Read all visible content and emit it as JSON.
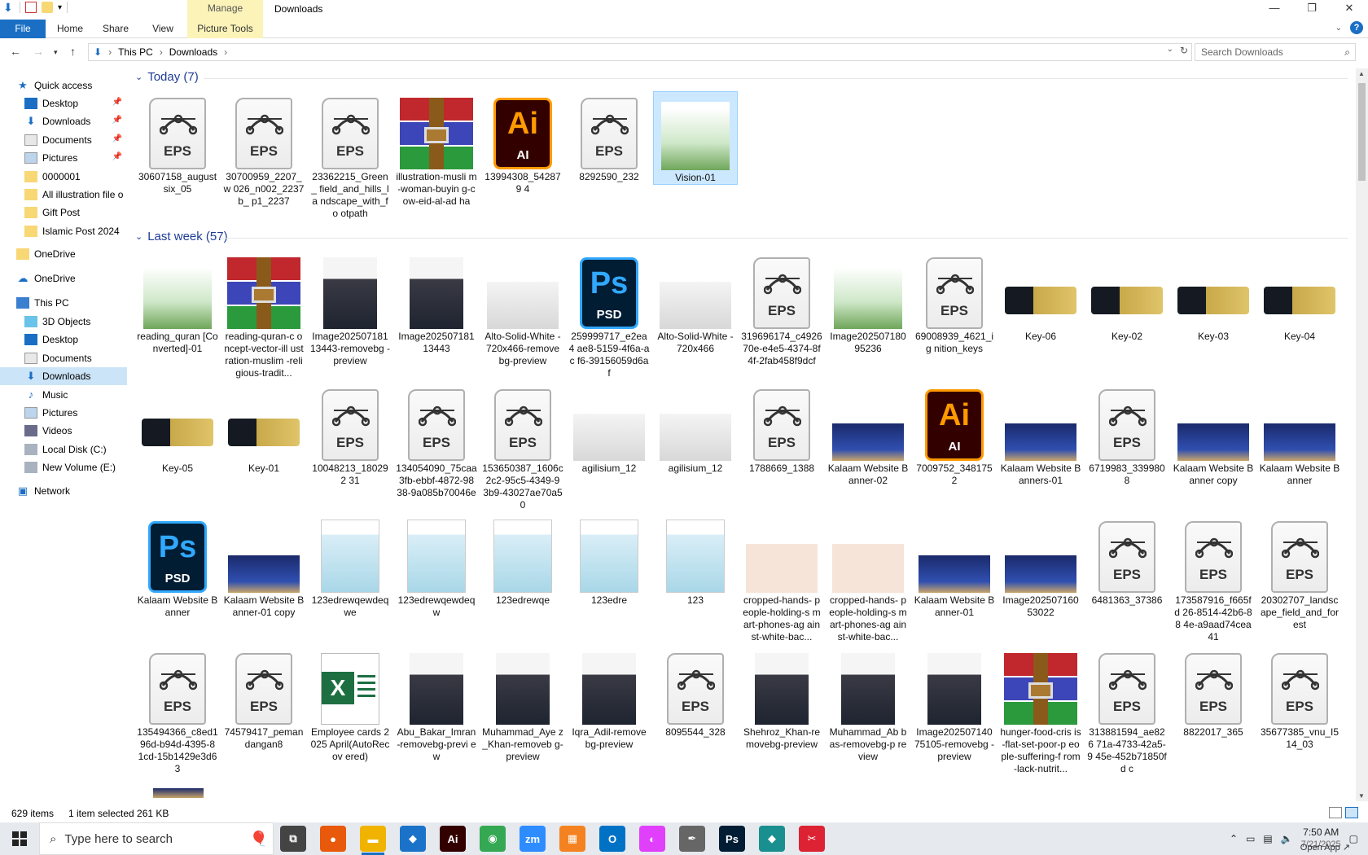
{
  "window": {
    "title": "Downloads",
    "contextual_tab_group": "Manage",
    "controls": {
      "minimize": "—",
      "restore": "❐",
      "close": "✕"
    }
  },
  "ribbon": {
    "tabs": [
      "File",
      "Home",
      "Share",
      "View"
    ],
    "contextual_tab": "Picture Tools",
    "help": "?"
  },
  "address": {
    "crumbs": [
      "This PC",
      "Downloads"
    ],
    "search_placeholder": "Search Downloads"
  },
  "sidebar": {
    "items": [
      {
        "label": "Quick access",
        "icon": "star-icon",
        "pinned": false
      },
      {
        "label": "Desktop",
        "icon": "desktop-icon",
        "pinned": true
      },
      {
        "label": "Downloads",
        "icon": "download-arrow-icon",
        "pinned": true
      },
      {
        "label": "Documents",
        "icon": "documents-icon",
        "pinned": true
      },
      {
        "label": "Pictures",
        "icon": "pictures-icon",
        "pinned": true
      },
      {
        "label": "0000001",
        "icon": "folder-icon",
        "pinned": false
      },
      {
        "label": "All illustration file o",
        "icon": "folder-icon",
        "pinned": false
      },
      {
        "label": "Gift Post",
        "icon": "folder-icon",
        "pinned": false
      },
      {
        "label": "Islamic Post 2024",
        "icon": "folder-icon",
        "pinned": false
      },
      {
        "label": "OneDrive",
        "icon": "folder-icon",
        "pinned": false
      },
      {
        "label": "OneDrive",
        "icon": "cloud-icon",
        "pinned": false
      },
      {
        "label": "This PC",
        "icon": "computer-icon",
        "pinned": false
      },
      {
        "label": "3D Objects",
        "icon": "cube-icon",
        "pinned": false
      },
      {
        "label": "Desktop",
        "icon": "desktop-icon",
        "pinned": false
      },
      {
        "label": "Documents",
        "icon": "documents-icon",
        "pinned": false
      },
      {
        "label": "Downloads",
        "icon": "download-arrow-icon",
        "pinned": false,
        "selected": true
      },
      {
        "label": "Music",
        "icon": "music-icon",
        "pinned": false
      },
      {
        "label": "Pictures",
        "icon": "pictures-icon",
        "pinned": false
      },
      {
        "label": "Videos",
        "icon": "videos-icon",
        "pinned": false
      },
      {
        "label": "Local Disk (C:)",
        "icon": "drive-icon",
        "pinned": false
      },
      {
        "label": "New Volume (E:)",
        "icon": "drive-icon",
        "pinned": false
      },
      {
        "label": "Network",
        "icon": "network-icon",
        "pinned": false
      }
    ]
  },
  "groups": [
    {
      "header": "Today (7)",
      "rows": [
        [
          {
            "label": "30607158_august six_05",
            "type": "eps"
          },
          {
            "label": "30700959_2207_w 026_n002_2237b_ p1_2237",
            "type": "eps"
          },
          {
            "label": "23362215_Green_ field_and_hills_la ndscape_with_fo otpath",
            "type": "eps"
          },
          {
            "label": "illustration-musli m-woman-buyin g-cow-eid-al-ad ha",
            "type": "rar"
          },
          {
            "label": "13994308_542879 4",
            "type": "ai"
          },
          {
            "label": "8292590_232",
            "type": "eps"
          },
          {
            "label": "Vision-01",
            "type": "image",
            "selected": true
          }
        ]
      ]
    },
    {
      "header": "Last week (57)",
      "rows": [
        [
          {
            "label": "reading_quran [Converted]-01",
            "type": "image"
          },
          {
            "label": "reading-quran-c oncept-vector-ill ustration-muslim -religious-tradit...",
            "type": "rar"
          },
          {
            "label": "Image202507181 13443-removebg -preview",
            "type": "photo"
          },
          {
            "label": "Image202507181 13443",
            "type": "photo"
          },
          {
            "label": "Alto-Solid-White -720x466-remove bg-preview",
            "type": "car"
          },
          {
            "label": "259999717_e2ea4 ae8-5159-4f6a-ac f6-39156059d6af",
            "type": "psd"
          },
          {
            "label": "Alto-Solid-White -720x466",
            "type": "car"
          },
          {
            "label": "319696174_c4926 70e-e4e5-4374-8f 4f-2fab458f9dcf",
            "type": "eps"
          },
          {
            "label": "Image202507180 95236",
            "type": "image"
          },
          {
            "label": "69008939_4621_ig nition_keys",
            "type": "eps"
          },
          {
            "label": "Key-06",
            "type": "key"
          },
          {
            "label": "Key-02",
            "type": "key"
          },
          {
            "label": "Key-03",
            "type": "key"
          },
          {
            "label": "Key-04",
            "type": "key"
          }
        ],
        [
          {
            "label": "Key-05",
            "type": "key"
          },
          {
            "label": "Key-01",
            "type": "key"
          },
          {
            "label": "10048213_180292 31",
            "type": "eps"
          },
          {
            "label": "134054090_75caa 3fb-ebbf-4872-98 38-9a085b70046e",
            "type": "eps"
          },
          {
            "label": "153650387_1606c 2c2-95c5-4349-9 3b9-43027ae70a5 0",
            "type": "eps"
          },
          {
            "label": "agilisium_12",
            "type": "car"
          },
          {
            "label": "agilisium_12",
            "type": "car"
          },
          {
            "label": "1788669_1388",
            "type": "eps"
          },
          {
            "label": "Kalaam Website Banner-02",
            "type": "banner"
          },
          {
            "label": "7009752_3481752",
            "type": "ai"
          },
          {
            "label": "Kalaam Website Banners-01",
            "type": "banner"
          },
          {
            "label": "6719983_3399808",
            "type": "eps"
          },
          {
            "label": "Kalaam Website Banner copy",
            "type": "banner"
          },
          {
            "label": "Kalaam Website Banner",
            "type": "banner"
          }
        ],
        [
          {
            "label": "Kalaam Website Banner",
            "type": "psd"
          },
          {
            "label": "Kalaam Website Banner-01 copy",
            "type": "banner"
          },
          {
            "label": "123edrewqewdeq we",
            "type": "doc"
          },
          {
            "label": "123edrewqewdeq w",
            "type": "doc"
          },
          {
            "label": "123edrewqe",
            "type": "doc"
          },
          {
            "label": "123edre",
            "type": "doc"
          },
          {
            "label": "123",
            "type": "doc"
          },
          {
            "label": "cropped-hands- people-holding-s mart-phones-ag ainst-white-bac...",
            "type": "hands"
          },
          {
            "label": "cropped-hands- people-holding-s mart-phones-ag ainst-white-bac...",
            "type": "hands"
          },
          {
            "label": "Kalaam Website Banner-01",
            "type": "banner"
          },
          {
            "label": "Image202507160 53022",
            "type": "banner"
          },
          {
            "label": "6481363_37386",
            "type": "eps"
          },
          {
            "label": "173587916_f665fd 26-8514-42b6-88 4e-a9aad74cea41",
            "type": "eps"
          },
          {
            "label": "20302707_landsc ape_field_and_for est",
            "type": "eps"
          }
        ],
        [
          {
            "label": "135494366_c8ed1 96d-b94d-4395-8 1cd-15b1429e3d6 3",
            "type": "eps"
          },
          {
            "label": "74579417_peman dangan8",
            "type": "eps"
          },
          {
            "label": "Employee cards 2025 April(AutoRecov ered)",
            "type": "xls"
          },
          {
            "label": "Abu_Bakar_Imran -removebg-previ ew",
            "type": "photo"
          },
          {
            "label": "Muhammad_Aye z_Khan-removeb g-preview",
            "type": "photo"
          },
          {
            "label": "Iqra_Adil-remove bg-preview",
            "type": "photo"
          },
          {
            "label": "8095544_328",
            "type": "eps"
          },
          {
            "label": "Shehroz_Khan-re movebg-preview",
            "type": "photo"
          },
          {
            "label": "Muhammad_Ab bas-removebg-p review",
            "type": "photo"
          },
          {
            "label": "Image202507140 75105-removebg -preview",
            "type": "photo"
          },
          {
            "label": "hunger-food-cris is-flat-set-poor-p eople-suffering-f rom-lack-nutrit...",
            "type": "rar"
          },
          {
            "label": "313881594_ae826 71a-4733-42a5-9 45e-452b71850fd c",
            "type": "eps"
          },
          {
            "label": "8822017_365",
            "type": "eps"
          },
          {
            "label": "35677385_vnu_I5 14_03",
            "type": "eps"
          }
        ]
      ]
    }
  ],
  "status": {
    "items": "629 items",
    "selection": "1 item selected  261 KB"
  },
  "taskbar": {
    "search_placeholder": "Type here to search",
    "apps": [
      {
        "name": "task-view",
        "label": "⧉",
        "color": "#444"
      },
      {
        "name": "firefox",
        "label": "●",
        "color": "#e8590c"
      },
      {
        "name": "file-explorer",
        "label": "▬",
        "color": "#f0b400",
        "active": true
      },
      {
        "name": "vscode",
        "label": "◆",
        "color": "#1a73c9"
      },
      {
        "name": "illustrator",
        "label": "Ai",
        "color": "#330000"
      },
      {
        "name": "chrome",
        "label": "◉",
        "color": "#34a853"
      },
      {
        "name": "zoom",
        "label": "zm",
        "color": "#2d8cff"
      },
      {
        "name": "app-orange",
        "label": "▦",
        "color": "#f58220"
      },
      {
        "name": "outlook",
        "label": "O",
        "color": "#0072c6"
      },
      {
        "name": "app-pink",
        "label": "◐",
        "color": "#e040fb"
      },
      {
        "name": "pen-tool",
        "label": "✒",
        "color": "#666"
      },
      {
        "name": "photoshop",
        "label": "Ps",
        "color": "#001d34"
      },
      {
        "name": "app-teal",
        "label": "◆",
        "color": "#1a8f8f"
      },
      {
        "name": "app-red",
        "label": "✂",
        "color": "#d23"
      }
    ],
    "clock_time": "7:50 AM",
    "clock_date": "7/21/2025",
    "open_app": "Open App ↗"
  },
  "colors": {
    "accent": "#1a6fc4",
    "selection": "#cce8ff",
    "group_header": "#1e3c96",
    "manage_tab": "#fbf3b8"
  }
}
